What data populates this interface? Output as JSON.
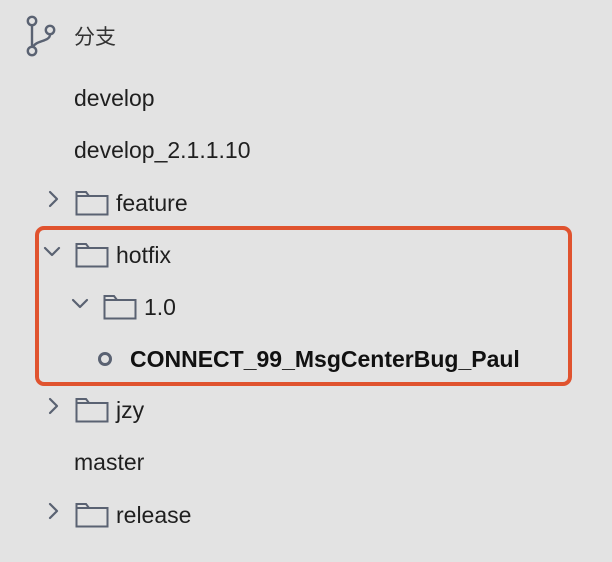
{
  "header": {
    "title": "分支",
    "icon": "git-branch-icon"
  },
  "tree": {
    "develop": "develop",
    "develop_2": "develop_2.1.1.10",
    "feature": "feature",
    "hotfix": "hotfix",
    "hotfix_version": "1.0",
    "hotfix_branch": "CONNECT_99_MsgCenterBug_Paul",
    "jzy": "jzy",
    "master": "master",
    "release": "release"
  },
  "colors": {
    "background": "#e3e3e3",
    "highlight_border": "#e0532f",
    "icon_stroke": "#5a6272"
  }
}
